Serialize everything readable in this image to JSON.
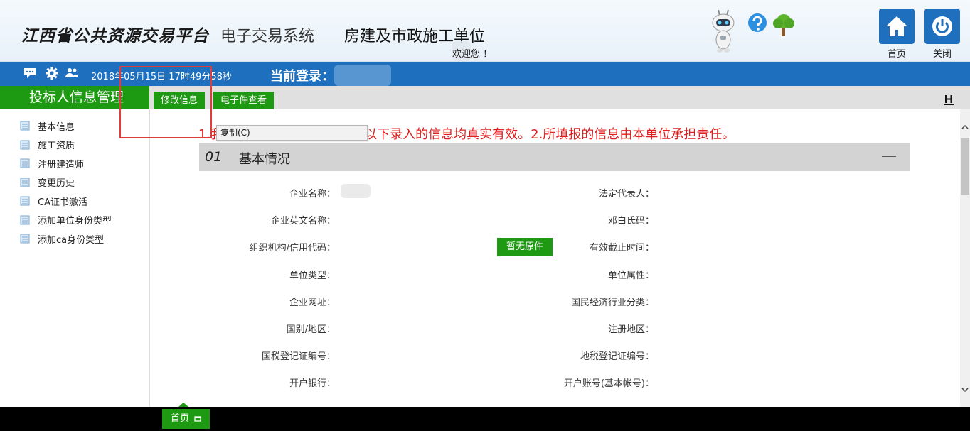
{
  "header": {
    "title_main": "江西省公共资源交易平台",
    "title_sub": "电子交易系统",
    "title_unit": "房建及市政施工单位",
    "welcome": "欢迎您 ！",
    "home_label": "首页",
    "close_label": "关闭"
  },
  "bluebar": {
    "datetime": "2018年05月15日 17时49分58秒",
    "login_label": "当前登录："
  },
  "sidebar": {
    "title": "投标人信息管理",
    "items": [
      {
        "label": "基本信息"
      },
      {
        "label": "施工资质"
      },
      {
        "label": "注册建造师"
      },
      {
        "label": "变更历史"
      },
      {
        "label": "CA证书激活"
      },
      {
        "label": "添加单位身份类型"
      },
      {
        "label": "添加ca身份类型"
      }
    ]
  },
  "toolbar": {
    "edit_label": "修改信息",
    "efile_label": "电子件查看"
  },
  "main": {
    "notice": "1.我单位已经填写了承诺书，以下录入的信息均真实有效。2.所填报的信息由本单位承担责任。",
    "context_menu": "复制(C)",
    "section": {
      "number": "01",
      "title": "基本情况"
    },
    "no_original": "暂无原件",
    "fields_left": [
      "企业名称：",
      "企业英文名称：",
      "组织机构/信用代码：",
      "单位类型：",
      "企业网址：",
      "国别/地区：",
      "国税登记证编号：",
      "开户银行："
    ],
    "fields_right": [
      "法定代表人：",
      "邓白氏码：",
      "有效截止时间：",
      "单位属性：",
      "国民经济行业分类：",
      "注册地区：",
      "地税登记证编号：",
      "开户账号(基本帐号)："
    ]
  },
  "bottombar": {
    "home_tab": "首页"
  },
  "colors": {
    "primary_blue": "#1e6fbe",
    "accent_green": "#1e9a12",
    "notice_red": "#e02020"
  }
}
